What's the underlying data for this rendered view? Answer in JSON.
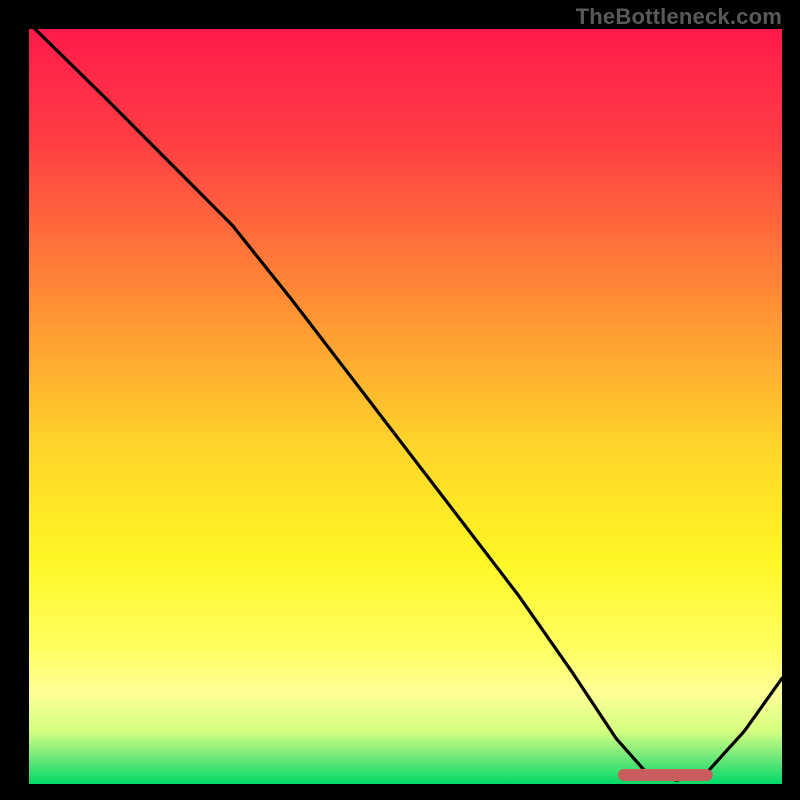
{
  "watermark": "TheBottleneck.com",
  "chart_data": {
    "type": "line",
    "title": "",
    "xlabel": "",
    "ylabel": "",
    "xlim": [
      0,
      100
    ],
    "ylim": [
      0,
      100
    ],
    "grid": false,
    "background_gradient": {
      "stops": [
        {
          "offset": 0.0,
          "color": "#ff1a4b"
        },
        {
          "offset": 0.15,
          "color": "#ff3e43"
        },
        {
          "offset": 0.35,
          "color": "#ff8a36"
        },
        {
          "offset": 0.55,
          "color": "#ffd42a"
        },
        {
          "offset": 0.7,
          "color": "#fff625"
        },
        {
          "offset": 0.82,
          "color": "#ffff60"
        },
        {
          "offset": 0.88,
          "color": "#ffff98"
        },
        {
          "offset": 0.93,
          "color": "#d4ff7f"
        },
        {
          "offset": 0.965,
          "color": "#6fe87a"
        },
        {
          "offset": 1.0,
          "color": "#00d967"
        }
      ]
    },
    "series": [
      {
        "name": "curve",
        "x": [
          0.8,
          10,
          20,
          27,
          35,
          45,
          55,
          65,
          72,
          78,
          82,
          86,
          90,
          95,
          100
        ],
        "y": [
          100,
          91,
          81,
          74,
          64,
          51,
          38,
          25,
          15,
          6,
          1.5,
          0.5,
          1.5,
          7,
          14
        ]
      }
    ],
    "marker": {
      "name": "optimal-range",
      "x_start": 79,
      "x_end": 90,
      "y": 1.2,
      "color": "#c75d5d"
    }
  }
}
